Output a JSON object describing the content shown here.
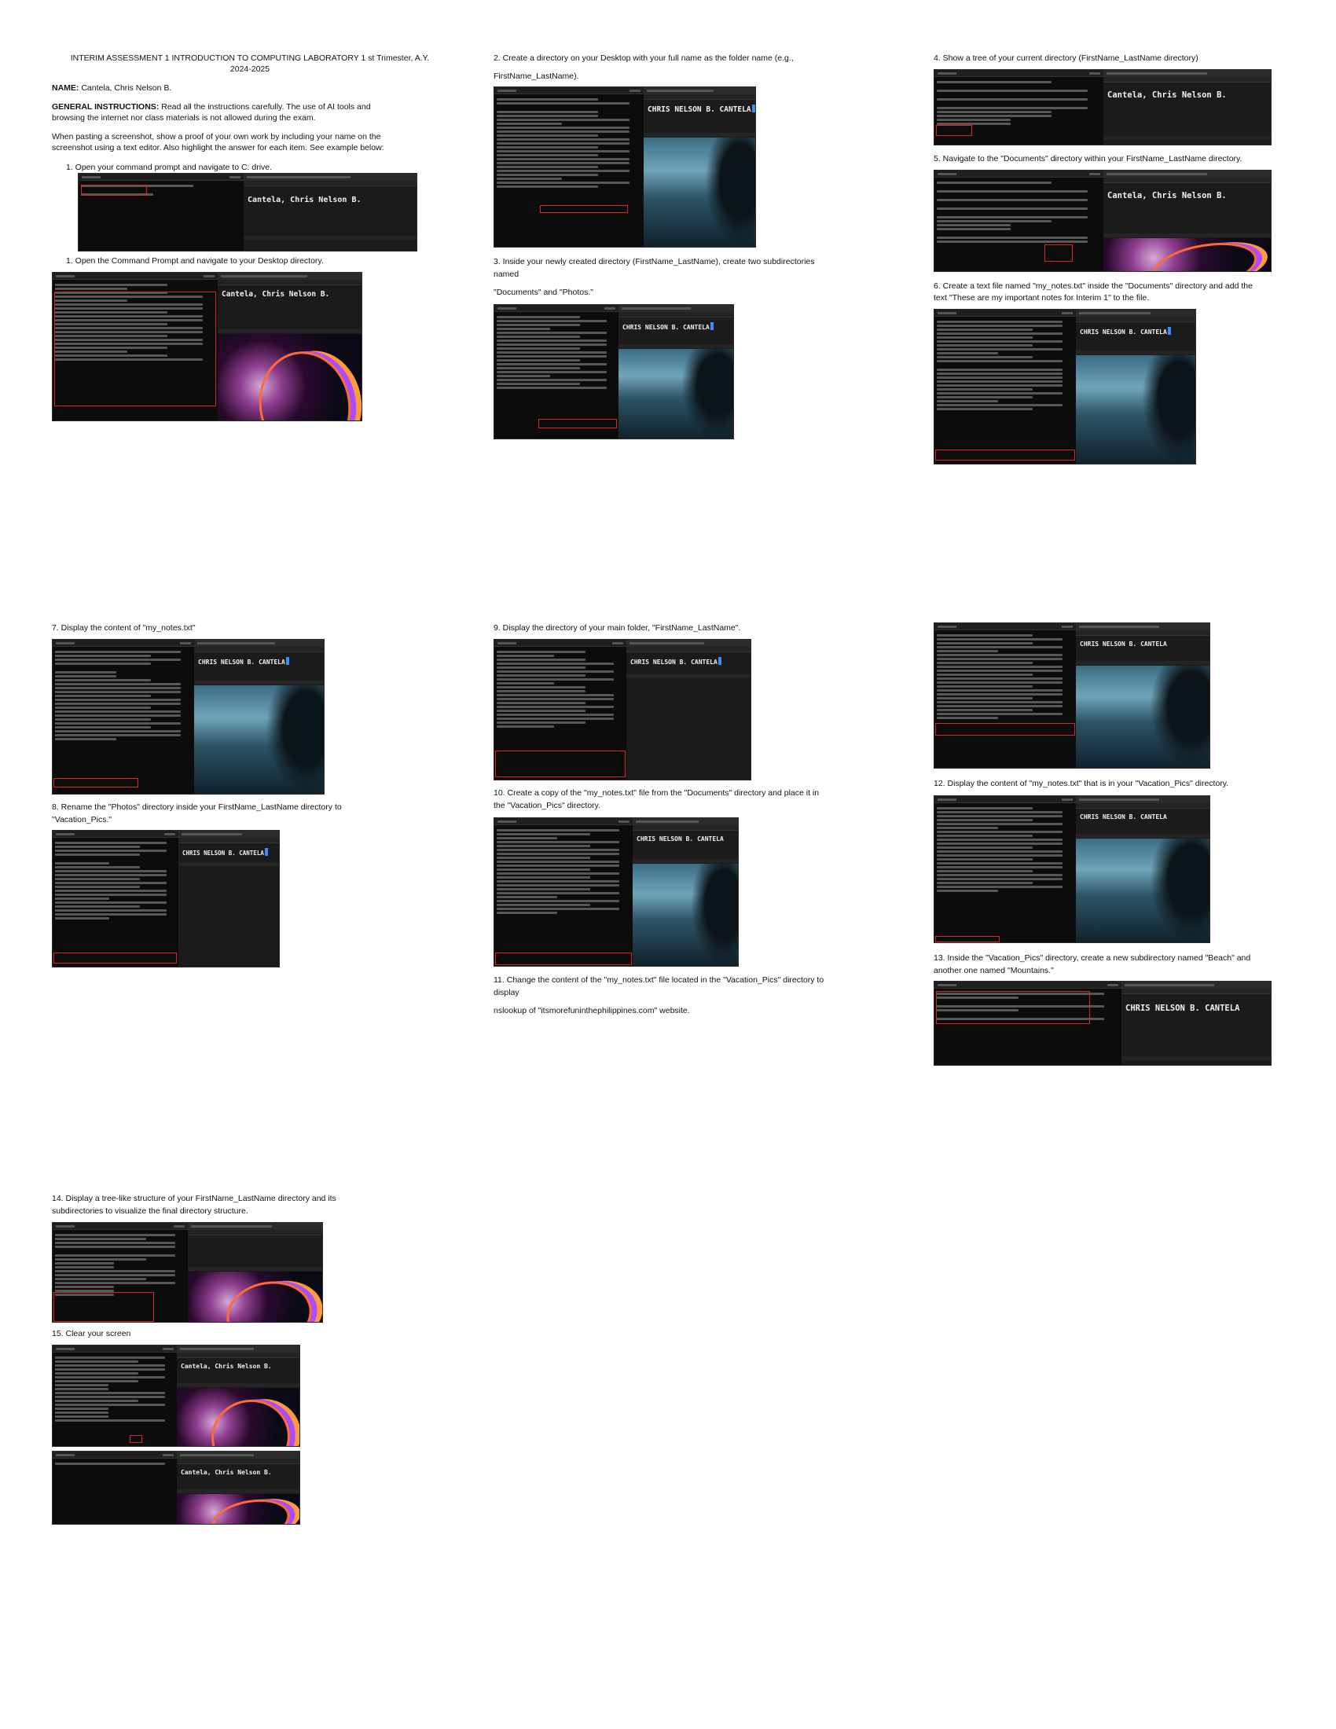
{
  "header": {
    "title_line1": "INTERIM ASSESSMENT 1 INTRODUCTION TO COMPUTING LABORATORY 1 st Trimester, A.Y.",
    "title_line2": "2024-2025",
    "name_label": "NAME:",
    "name_value": "Cantela, Chris Nelson B.",
    "gi_label": "GENERAL INSTRUCTIONS:",
    "gi_text": "Read all the instructions carefully. The use of AI tools and browsing the internet nor class materials is not allowed during the exam.",
    "paste_text": "When pasting a screenshot, show a proof of your own work by including your name on the screenshot using a text editor. Also highlight the answer for each item. See example below:"
  },
  "screenshot_names": {
    "mixed": "Cantela, Chris Nelson B.",
    "upper": "CHRIS NELSON B. CANTELA"
  },
  "items": {
    "i1": "1. Open your command prompt and navigate to C: drive.",
    "i1b": "1. Open the Command Prompt and navigate to your Desktop directory.",
    "i2a": "2. Create a directory on your Desktop with your full name as the folder name (e.g.,",
    "i2b": "FirstName_LastName).",
    "i3a": "3. Inside your newly created directory (FirstName_LastName), create two subdirectories",
    "i3b": "named",
    "i3c": "\"Documents\" and \"Photos.\"",
    "i4": "4. Show a tree of your current directory (FirstName_LastName directory)",
    "i5": "5. Navigate to the \"Documents\" directory within your FirstName_LastName directory.",
    "i6a": "6. Create a text file named \"my_notes.txt\" inside the \"Documents\" directory and add the",
    "i6b": "text \"These are my important notes for Interim 1\" to the file.",
    "i7": "7. Display the content of \"my_notes.txt\"",
    "i8a": "8. Rename the \"Photos\" directory inside your FirstName_LastName directory to",
    "i8b": "\"Vacation_Pics.\"",
    "i9": "9. Display the directory of your main folder, \"FirstName_LastName\".",
    "i10a": "10. Create a copy of the \"my_notes.txt\" file from the \"Documents\" directory and place it in",
    "i10b": "the \"Vacation_Pics\" directory.",
    "i11a": "11. Change the content of the \"my_notes.txt\" file located in the \"Vacation_Pics\" directory to",
    "i11b": "display",
    "i11c": "nslookup of \"itsmorefuninthephilippines.com\" website.",
    "i12": "12. Display the content of \"my_notes.txt\" that is in your \"Vacation_Pics\" directory.",
    "i13a": "13. Inside the \"Vacation_Pics\" directory, create a new subdirectory named \"Beach\" and",
    "i13b": "another one named \"Mountains.\"",
    "i14a": "14. Display a tree-like structure of your FirstName_LastName directory and its",
    "i14b": "subdirectories to visualize the final directory structure.",
    "i15": "15. Clear your screen"
  }
}
